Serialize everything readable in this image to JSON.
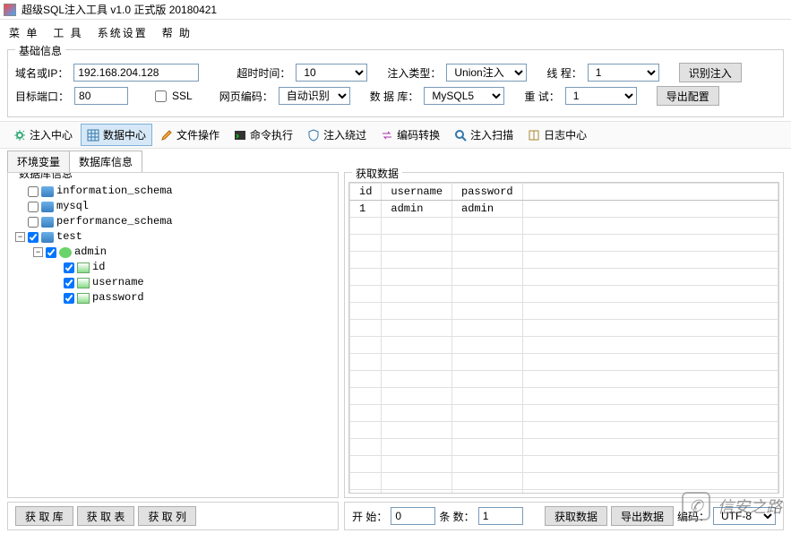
{
  "title": "超级SQL注入工具 v1.0 正式版 20180421",
  "menu": {
    "items": [
      "菜 单",
      "工 具",
      "系统设置",
      "帮 助"
    ]
  },
  "basic": {
    "legend": "基础信息",
    "domain_label": "域名或IP：",
    "domain_value": "192.168.204.128",
    "timeout_label": "超时时间：",
    "timeout_value": "10",
    "inject_type_label": "注入类型：",
    "inject_type_value": "Union注入",
    "thread_label": "线 程：",
    "thread_value": "1",
    "identify_btn": "识别注入",
    "port_label": "目标端口：",
    "port_value": "80",
    "ssl_label": "SSL",
    "encoding_label": "网页编码：",
    "encoding_value": "自动识别",
    "db_label": "数 据 库：",
    "db_value": "MySQL5",
    "retry_label": "重 试：",
    "retry_value": "1",
    "export_btn": "导出配置"
  },
  "toolbar": {
    "items": [
      {
        "id": "inject-center",
        "label": "注入中心",
        "icon": "gear"
      },
      {
        "id": "data-center",
        "label": "数据中心",
        "icon": "grid",
        "active": true
      },
      {
        "id": "file-op",
        "label": "文件操作",
        "icon": "pencil"
      },
      {
        "id": "cmd-exec",
        "label": "命令执行",
        "icon": "terminal"
      },
      {
        "id": "inject-bypass",
        "label": "注入绕过",
        "icon": "shield"
      },
      {
        "id": "enc-convert",
        "label": "编码转换",
        "icon": "swap"
      },
      {
        "id": "inject-scan",
        "label": "注入扫描",
        "icon": "search"
      },
      {
        "id": "log-center",
        "label": "日志中心",
        "icon": "book"
      }
    ]
  },
  "subtabs": {
    "items": [
      "环境变量",
      "数据库信息"
    ],
    "active": 1
  },
  "tree": {
    "legend": "数据库信息",
    "nodes": [
      {
        "depth": 0,
        "toggle": "",
        "checked": false,
        "icon": "db",
        "label": "information_schema"
      },
      {
        "depth": 0,
        "toggle": "",
        "checked": false,
        "icon": "db",
        "label": "mysql"
      },
      {
        "depth": 0,
        "toggle": "",
        "checked": false,
        "icon": "db",
        "label": "performance_schema"
      },
      {
        "depth": 0,
        "toggle": "-",
        "checked": true,
        "icon": "db",
        "label": "test"
      },
      {
        "depth": 1,
        "toggle": "-",
        "checked": true,
        "icon": "tbl",
        "label": "admin"
      },
      {
        "depth": 2,
        "toggle": "",
        "checked": true,
        "icon": "col",
        "label": "id"
      },
      {
        "depth": 2,
        "toggle": "",
        "checked": true,
        "icon": "col",
        "label": "username"
      },
      {
        "depth": 2,
        "toggle": "",
        "checked": true,
        "icon": "col",
        "label": "password"
      }
    ]
  },
  "grid": {
    "legend": "获取数据",
    "columns": [
      "id",
      "username",
      "password"
    ],
    "rows": [
      [
        "1",
        "admin",
        "admin"
      ]
    ]
  },
  "bottom_left": {
    "btns": [
      "获 取 库",
      "获 取 表",
      "获 取 列"
    ]
  },
  "bottom_right": {
    "start_label": "开 始：",
    "start_value": "0",
    "count_label": "条 数：",
    "count_value": "1",
    "fetch_btn": "获取数据",
    "export_btn": "导出数据",
    "enc_label": "编码：",
    "enc_value": "UTF-8"
  },
  "watermark": "信安之路"
}
